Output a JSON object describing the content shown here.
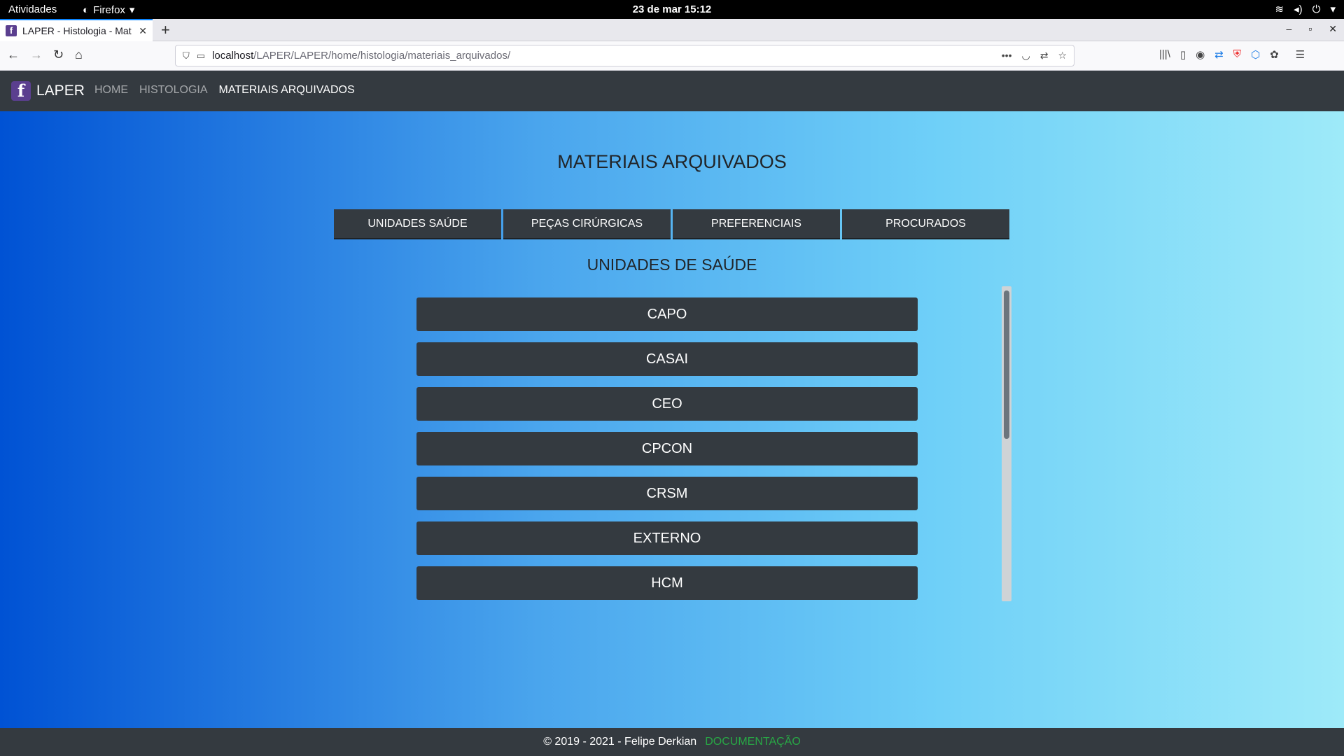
{
  "system_bar": {
    "activities": "Atividades",
    "app_name": "Firefox",
    "clock": "23 de mar  15:12"
  },
  "browser": {
    "tab_title": "LAPER - Histologia - Mat",
    "url_host": "localhost",
    "url_path": "/LAPER/LAPER/home/histologia/materiais_arquivados/"
  },
  "site": {
    "brand": "LAPER",
    "logo_letter": "f",
    "nav": [
      {
        "label": "HOME"
      },
      {
        "label": "HISTOLOGIA"
      },
      {
        "label": "MATERIAIS ARQUIVADOS"
      }
    ]
  },
  "main": {
    "title": "MATERIAIS ARQUIVADOS",
    "tabs": [
      {
        "label": "UNIDADES SAÚDE"
      },
      {
        "label": "PEÇAS CIRÚRGICAS"
      },
      {
        "label": "PREFERENCIAIS"
      },
      {
        "label": "PROCURADOS"
      }
    ],
    "section_title": "UNIDADES DE SAÚDE",
    "units": [
      {
        "label": "CAPO"
      },
      {
        "label": "CASAI"
      },
      {
        "label": "CEO"
      },
      {
        "label": "CPCON"
      },
      {
        "label": "CRSM"
      },
      {
        "label": "EXTERNO"
      },
      {
        "label": "HCM"
      }
    ]
  },
  "footer": {
    "copyright": "© 2019 - 2021 - Felipe Derkian",
    "doc_link": "DOCUMENTAÇÃO"
  },
  "colors": {
    "dark": "#343a40",
    "link_green": "#28a745",
    "brand_purple": "#5b3f8f"
  }
}
